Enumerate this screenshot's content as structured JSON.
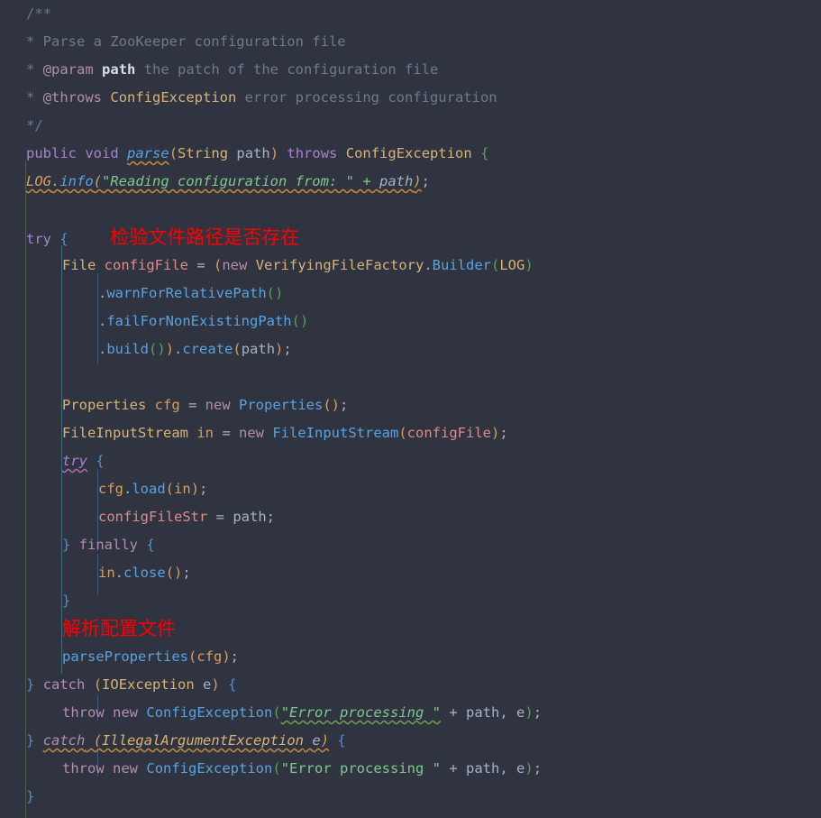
{
  "editor": {
    "background": "#2f3440",
    "default_text_color": "#a9b1c1",
    "annotation_color": "#ff0000",
    "language": "Java"
  },
  "javadoc": {
    "open": "/**",
    "line1_star": "*",
    "line1_text": " Parse a ZooKeeper configuration file",
    "line2_star": "*",
    "line2_tag": "@param",
    "line2_param": "path",
    "line2_text": " the patch of the configuration file",
    "line3_star": "*",
    "line3_tag": "@throws",
    "line3_type": "ConfigException",
    "line3_text": " error processing configuration",
    "close": "*/"
  },
  "code": {
    "signature": {
      "modifier": "public",
      "return_type": "void",
      "method_name": "parse",
      "paren_open": "(",
      "param_type": "String",
      "param_name": "path",
      "paren_close": ")",
      "throws_kw": "throws",
      "throws_type": "ConfigException",
      "brace_open": "{"
    },
    "log_line": {
      "logger": "LOG",
      "dot": ".",
      "method": "info",
      "paren_open": "(",
      "string": "\"Reading configuration from: \"",
      "plus": " + ",
      "arg": "path",
      "paren_close": ")",
      "semi": ";"
    },
    "try_kw": "try",
    "try_brace": "{",
    "annotation_1": "检验文件路径是否存在",
    "config_file_line": {
      "type": "File",
      "var": "configFile",
      "assign": " = ",
      "paren_open": "(",
      "new_kw": "new",
      "class_name": "VerifyingFileFactory",
      "dot": ".",
      "inner_class": "Builder",
      "inner_paren_open": "(",
      "arg": "LOG",
      "inner_paren_close": ")"
    },
    "chain": [
      {
        "dot": ".",
        "method": "warnForRelativePath",
        "parens": "()"
      },
      {
        "dot": ".",
        "method": "failForNonExistingPath",
        "parens": "()"
      }
    ],
    "build_line": {
      "dot": ".",
      "method": "build",
      "paren_inner": "()",
      "paren_close": ")",
      "dot2": ".",
      "method2": "create",
      "paren_open2": "(",
      "arg": "path",
      "paren_close2": ")",
      "semi": ";"
    },
    "properties_line": {
      "type": "Properties",
      "var": "cfg",
      "assign": " = ",
      "new_kw": "new",
      "ctor": "Properties",
      "parens": "()",
      "semi": ";"
    },
    "stream_line": {
      "type": "FileInputStream",
      "var": "in",
      "assign": " = ",
      "new_kw": "new",
      "ctor": "FileInputStream",
      "paren_open": "(",
      "arg": "configFile",
      "paren_close": ")",
      "semi": ";"
    },
    "inner_try_kw": "try",
    "inner_try_brace": "{",
    "load_line": {
      "obj": "cfg",
      "dot": ".",
      "method": "load",
      "paren_open": "(",
      "arg": "in",
      "paren_close": ")",
      "semi": ";"
    },
    "assign_line": {
      "field": "configFileStr",
      "assign": " = ",
      "value": "path",
      "semi": ";"
    },
    "finally_close_brace": "}",
    "finally_kw": "finally",
    "finally_brace": "{",
    "close_line": {
      "obj": "in",
      "dot": ".",
      "method": "close",
      "parens": "()",
      "semi": ";"
    },
    "inner_try_end_brace": "}",
    "annotation_2": "解析配置文件",
    "parse_properties_line": {
      "method": "parseProperties",
      "paren_open": "(",
      "arg": "cfg",
      "paren_close": ")",
      "semi": ";"
    },
    "catch_io": {
      "close_brace": "}",
      "catch_kw": "catch",
      "paren_open": "(",
      "exception": "IOException",
      "var": "e",
      "paren_close": ")",
      "brace_open": "{"
    },
    "throw_io": {
      "throw_kw": "throw",
      "new_kw": "new",
      "exception": "ConfigException",
      "paren_open": "(",
      "string": "\"Error processing \"",
      "plus": " + ",
      "arg1": "path",
      "comma": ", ",
      "arg2": "e",
      "paren_close": ")",
      "semi": ";"
    },
    "catch_illegal": {
      "close_brace": "}",
      "catch_kw": "catch",
      "paren_open": "(",
      "exception": "IllegalArgumentException",
      "var": "e",
      "paren_close": ")",
      "brace_open": "{"
    },
    "throw_illegal": {
      "throw_kw": "throw",
      "new_kw": "new",
      "exception": "ConfigException",
      "paren_open": "(",
      "string": "\"Error processing \"",
      "plus": " + ",
      "arg1": "path",
      "comma": ", ",
      "arg2": "e",
      "paren_close": ")",
      "semi": ";"
    },
    "final_close_brace": "}"
  }
}
